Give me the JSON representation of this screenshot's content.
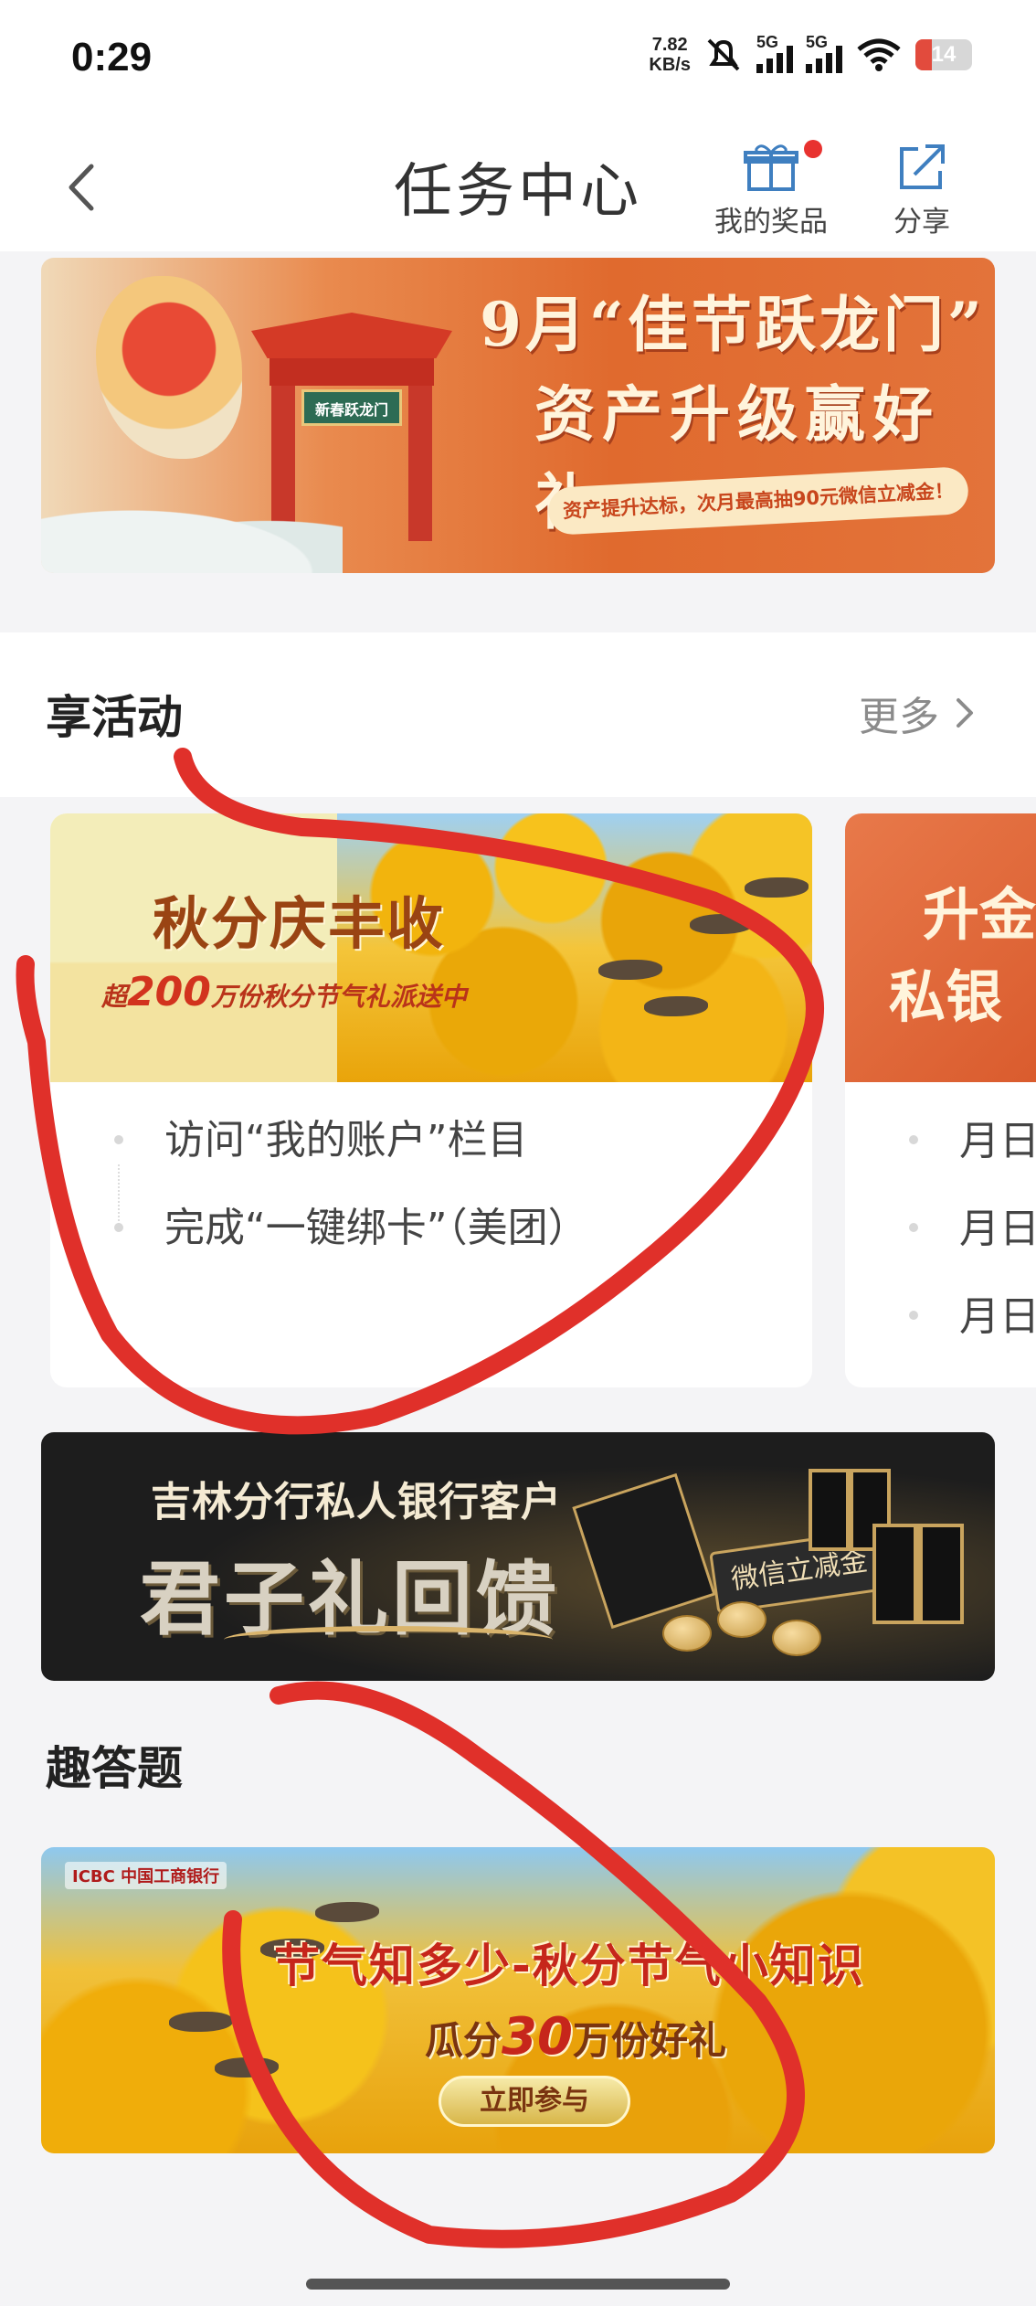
{
  "status_bar": {
    "time": "0:29",
    "net_speed_value": "7.82",
    "net_speed_unit": "KB/s",
    "signal1_label": "5G",
    "signal2_label": "5G",
    "wifi_label": "6",
    "battery": "14"
  },
  "header": {
    "title": "任务中心",
    "prizes_label": "我的奖品",
    "share_label": "分享"
  },
  "top_banner": {
    "line1": "9月“佳节跃龙门”",
    "line2": "资产升级赢好礼",
    "subtitle": "资产提升达标，次月最高抽90元微信立减金！",
    "gate_plaque": "新春跃龙门"
  },
  "activities": {
    "title": "享活动",
    "more_label": "更多",
    "cards": [
      {
        "banner_title": "秋分庆丰收",
        "banner_sub_prefix": "超",
        "banner_sub_number": "200",
        "banner_sub_suffix": "万份秋分节气礼派送中",
        "tasks": [
          "访问“我的账户”栏目",
          "完成“一键绑卡”（美团）"
        ]
      },
      {
        "banner_line1": "升金",
        "banner_line2": "私银",
        "tasks": [
          "月日",
          "月日",
          "月日"
        ]
      }
    ]
  },
  "private_bank_banner": {
    "line1": "吉林分行私人银行客户",
    "line2": "君子礼回馈",
    "tag": "微信立减金"
  },
  "quiz": {
    "title": "趣答题",
    "bank_logo": "ICBC 中国工商银行",
    "banner_title": "节气知多少-秋分节气小知识",
    "banner_sub_prefix": "瓜分",
    "banner_sub_number": "30",
    "banner_sub_suffix": "万份好礼",
    "cta": "立即参与"
  },
  "colors": {
    "annotation_red": "#e0302a",
    "accent_orange": "#e06a2e",
    "notification_dot": "#e8322f"
  }
}
